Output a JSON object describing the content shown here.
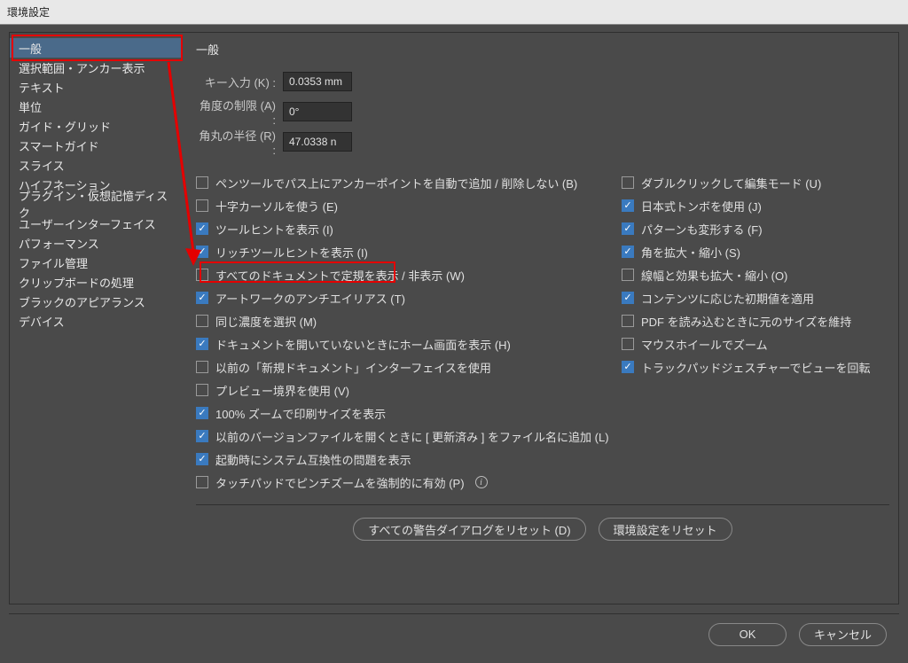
{
  "dialog_title": "環境設定",
  "sidebar": {
    "items": [
      {
        "label": "一般",
        "selected": true
      },
      {
        "label": "選択範囲・アンカー表示",
        "selected": false
      },
      {
        "label": "テキスト",
        "selected": false
      },
      {
        "label": "単位",
        "selected": false
      },
      {
        "label": "ガイド・グリッド",
        "selected": false
      },
      {
        "label": "スマートガイド",
        "selected": false
      },
      {
        "label": "スライス",
        "selected": false
      },
      {
        "label": "ハイフネーション",
        "selected": false
      },
      {
        "label": "プラグイン・仮想記憶ディスク",
        "selected": false
      },
      {
        "label": "ユーザーインターフェイス",
        "selected": false
      },
      {
        "label": "パフォーマンス",
        "selected": false
      },
      {
        "label": "ファイル管理",
        "selected": false
      },
      {
        "label": "クリップボードの処理",
        "selected": false
      },
      {
        "label": "ブラックのアピアランス",
        "selected": false
      },
      {
        "label": "デバイス",
        "selected": false
      }
    ]
  },
  "panel": {
    "title": "一般",
    "fields": {
      "key_label": "キー入力 (K) :",
      "key_value": "0.0353 mm",
      "angle_label": "角度の制限 (A) :",
      "angle_value": "0°",
      "corner_label": "角丸の半径 (R) :",
      "corner_value": "47.0338 n"
    },
    "checkboxes_left": [
      {
        "label": "ペンツールでパス上にアンカーポイントを自動で追加 / 削除しない (B)",
        "checked": false
      },
      {
        "label": "十字カーソルを使う (E)",
        "checked": false
      },
      {
        "label": "ツールヒントを表示 (I)",
        "checked": true
      },
      {
        "label": "リッチツールヒントを表示 (I)",
        "checked": true,
        "highlighted": true
      },
      {
        "label": "すべてのドキュメントで定規を表示 / 非表示 (W)",
        "checked": false
      },
      {
        "label": "アートワークのアンチエイリアス (T)",
        "checked": true
      },
      {
        "label": "同じ濃度を選択 (M)",
        "checked": false
      },
      {
        "label": "ドキュメントを開いていないときにホーム画面を表示 (H)",
        "checked": true
      },
      {
        "label": "以前の「新規ドキュメント」インターフェイスを使用",
        "checked": false
      },
      {
        "label": "プレビュー境界を使用 (V)",
        "checked": false
      },
      {
        "label": "100% ズームで印刷サイズを表示",
        "checked": true
      },
      {
        "label": "以前のバージョンファイルを開くときに [ 更新済み ] をファイル名に追加 (L)",
        "checked": true
      },
      {
        "label": "起動時にシステム互換性の問題を表示",
        "checked": true
      },
      {
        "label": "タッチパッドでピンチズームを強制的に有効 (P)",
        "checked": false,
        "info": true
      }
    ],
    "checkboxes_right": [
      {
        "label": "ダブルクリックして編集モード (U)",
        "checked": false
      },
      {
        "label": "日本式トンボを使用 (J)",
        "checked": true
      },
      {
        "label": "パターンも変形する (F)",
        "checked": true
      },
      {
        "label": "角を拡大・縮小 (S)",
        "checked": true
      },
      {
        "label": "線幅と効果も拡大・縮小 (O)",
        "checked": false
      },
      {
        "label": "コンテンツに応じた初期値を適用",
        "checked": true
      },
      {
        "label": "PDF を読み込むときに元のサイズを維持",
        "checked": false
      },
      {
        "label": "マウスホイールでズーム",
        "checked": false
      },
      {
        "label": "トラックパッドジェスチャーでビューを回転",
        "checked": true
      }
    ],
    "reset_warnings_label": "すべての警告ダイアログをリセット (D)",
    "reset_prefs_label": "環境設定をリセット"
  },
  "footer": {
    "ok_label": "OK",
    "cancel_label": "キャンセル"
  },
  "annotation_colors": {
    "red": "#e40000"
  }
}
